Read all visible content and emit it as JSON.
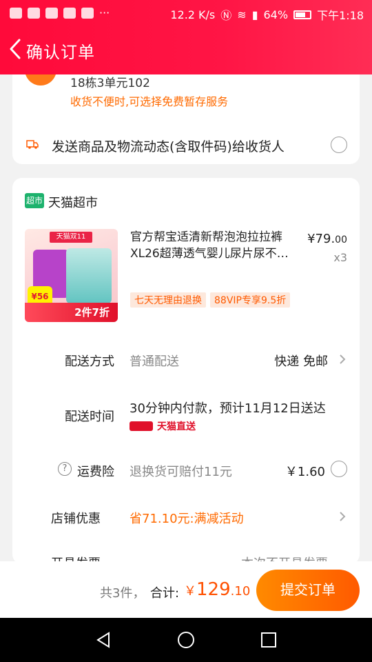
{
  "status_bar": {
    "speed": "12.2 K/s",
    "battery": "64%",
    "time": "下午1:18"
  },
  "header": {
    "title": "确认订单"
  },
  "address": {
    "line": "18栋3单元102",
    "hint": "收货不便时,可选择免费暂存服务",
    "notify_text": "发送商品及物流动态(含取件码)给收货人"
  },
  "shop": {
    "badge": "超市",
    "name": "天猫超市"
  },
  "product": {
    "name": "官方帮宝适清新帮泡泡拉拉裤XL26超薄透气婴儿尿片尿不…",
    "price_main": "¥79.",
    "price_decimal": "00",
    "qty": "x3",
    "tags": [
      "七天无理由退换",
      "88VIP专享9.5折"
    ],
    "thumb_banner": "天猫双11",
    "thumb_price": "¥56",
    "thumb_promo": "2件7折"
  },
  "delivery": {
    "label": "配送方式",
    "value": "普通配送",
    "right": "快递 免邮"
  },
  "delivery_time": {
    "label": "配送时间",
    "value": "30分钟内付款，预计11月12日送达",
    "service": "天猫直送"
  },
  "insurance": {
    "label": "运费险",
    "value": "退换货可赔付11元",
    "price": "￥1.60"
  },
  "shop_discount": {
    "label": "店铺优惠",
    "value": "省71.10元:满减活动"
  },
  "invoice": {
    "label": "开具发票",
    "value": "本次不开具发票"
  },
  "summary": {
    "count": "共3件，",
    "label": "合计:",
    "currency": "￥",
    "total_int": "129",
    "total_dec": ".10",
    "submit": "提交订单"
  },
  "colors": {
    "brand_red": "#ff0a3a",
    "accent_orange": "#ff5a00"
  }
}
